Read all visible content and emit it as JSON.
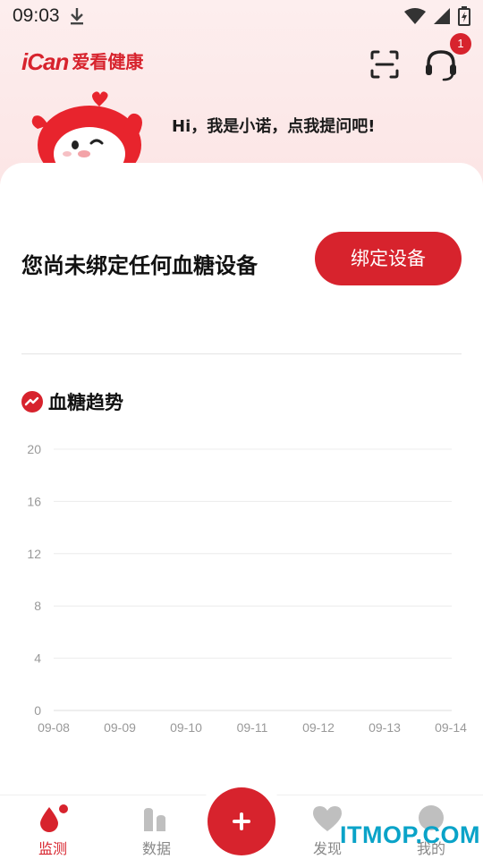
{
  "status_bar": {
    "time": "09:03"
  },
  "header": {
    "logo_latin": "iCan",
    "logo_cn": "爱看健康",
    "notification_count": "1"
  },
  "greeting": {
    "text": "Hi，我是小诺，点我提问吧!"
  },
  "device": {
    "message": "您尚未绑定任何血糖设备",
    "bind_label": "绑定设备"
  },
  "trend": {
    "title": "血糖趋势"
  },
  "chart_data": {
    "type": "line",
    "x": [
      "09-08",
      "09-09",
      "09-10",
      "09-11",
      "09-12",
      "09-13",
      "09-14"
    ],
    "yticks": [
      0,
      4,
      8,
      12,
      16,
      20
    ],
    "ylim": [
      0,
      20
    ],
    "series": [],
    "grid": true
  },
  "nav": {
    "items": [
      {
        "label": "监测"
      },
      {
        "label": "数据"
      },
      {
        "label": "发现"
      },
      {
        "label": "我的"
      }
    ]
  },
  "colors": {
    "accent": "#d7232d",
    "watermark": "#0aa3c8"
  },
  "watermark": "ITMOP.COM"
}
